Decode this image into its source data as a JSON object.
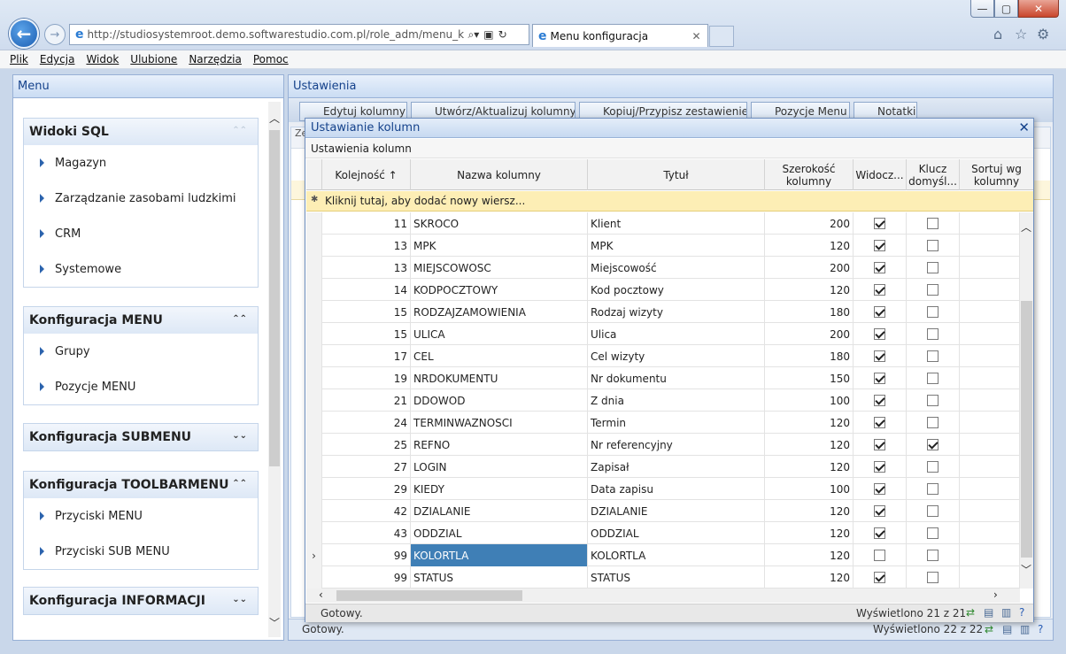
{
  "browser": {
    "url": "http://studiosystemroot.demo.softwarestudio.com.pl/role_adm/menu_konfigur",
    "tab_title": "Menu konfiguracja",
    "menu": [
      "Plik",
      "Edycja",
      "Widok",
      "Ulubione",
      "Narzędzia",
      "Pomoc"
    ]
  },
  "left_panel": {
    "title": "Menu",
    "sections": [
      {
        "title": "Widoki SQL",
        "items": [
          "Magazyn",
          "Zarządzanie zasobami ludzkimi",
          "CRM",
          "Systemowe"
        ]
      },
      {
        "title": "Konfiguracja MENU",
        "items": [
          "Grupy",
          "Pozycje MENU"
        ]
      },
      {
        "title": "Konfiguracja SUBMENU",
        "items": []
      },
      {
        "title": "Konfiguracja TOOLBARMENU",
        "items": [
          "Przyciski MENU",
          "Przyciski SUB MENU"
        ]
      },
      {
        "title": "Konfiguracja INFORMACJI",
        "items": []
      }
    ]
  },
  "right_panel": {
    "title": "Ustawienia",
    "toolbar": [
      "Edytuj kolumny",
      "Utwórz/Aktualizuj kolumny",
      "Kopiuj/Przypisz zestawienie",
      "Pozycje Menu",
      "Notatki"
    ],
    "behind_label": "Ze",
    "status": "Gotowy.",
    "status_right": "Wyświetlono 22 z 22"
  },
  "dialog": {
    "title": "Ustawianie kolumn",
    "subtitle": "Ustawienia kolumn",
    "columns": {
      "ord": "Kolejność ↑",
      "name": "Nazwa kolumny",
      "title": "Tytuł",
      "width": "Szerokość kolumny",
      "visible": "Widocz...",
      "key": "Klucz domyśl...",
      "sort": "Sortuj wg kolumny"
    },
    "new_row": "Kliknij tutaj, aby dodać nowy wiersz...",
    "rows": [
      {
        "ord": "11",
        "name": "SKROCO",
        "title": "Klient",
        "width": "200",
        "visible": true,
        "key": false
      },
      {
        "ord": "13",
        "name": "MPK",
        "title": "MPK",
        "width": "120",
        "visible": true,
        "key": false
      },
      {
        "ord": "13",
        "name": "MIEJSCOWOSC",
        "title": "Miejscowość",
        "width": "200",
        "visible": true,
        "key": false
      },
      {
        "ord": "14",
        "name": "KODPOCZTOWY",
        "title": "Kod pocztowy",
        "width": "120",
        "visible": true,
        "key": false
      },
      {
        "ord": "15",
        "name": "RODZAJZAMOWIENIA",
        "title": "Rodzaj wizyty",
        "width": "180",
        "visible": true,
        "key": false
      },
      {
        "ord": "15",
        "name": "ULICA",
        "title": "Ulica",
        "width": "200",
        "visible": true,
        "key": false
      },
      {
        "ord": "17",
        "name": "CEL",
        "title": "Cel wizyty",
        "width": "180",
        "visible": true,
        "key": false
      },
      {
        "ord": "19",
        "name": "NRDOKUMENTU",
        "title": "Nr dokumentu",
        "width": "150",
        "visible": true,
        "key": false
      },
      {
        "ord": "21",
        "name": "DDOWOD",
        "title": "Z dnia",
        "width": "100",
        "visible": true,
        "key": false
      },
      {
        "ord": "24",
        "name": "TERMINWAZNOSCI",
        "title": "Termin",
        "width": "120",
        "visible": true,
        "key": false
      },
      {
        "ord": "25",
        "name": "REFNO",
        "title": "Nr referencyjny",
        "width": "120",
        "visible": true,
        "key": true
      },
      {
        "ord": "27",
        "name": "LOGIN",
        "title": "Zapisał",
        "width": "120",
        "visible": true,
        "key": false
      },
      {
        "ord": "29",
        "name": "KIEDY",
        "title": "Data zapisu",
        "width": "100",
        "visible": true,
        "key": false
      },
      {
        "ord": "42",
        "name": "DZIALANIE",
        "title": "DZIALANIE",
        "width": "120",
        "visible": true,
        "key": false
      },
      {
        "ord": "43",
        "name": "ODDZIAL",
        "title": "ODDZIAL",
        "width": "120",
        "visible": true,
        "key": false
      },
      {
        "ord": "99",
        "name": "KOLORTLA",
        "title": "KOLORTLA",
        "width": "120",
        "visible": false,
        "key": false,
        "selected": true
      },
      {
        "ord": "99",
        "name": "STATUS",
        "title": "STATUS",
        "width": "120",
        "visible": true,
        "key": false
      }
    ],
    "status": "Gotowy.",
    "status_right": "Wyświetlono 21 z 21"
  }
}
